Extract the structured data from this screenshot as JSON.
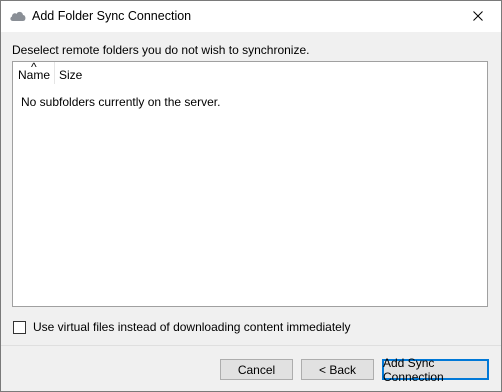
{
  "window": {
    "title": "Add Folder Sync Connection",
    "icon": "cloud-icon",
    "close_icon": "close-icon"
  },
  "instruction": "Deselect remote folders you do not wish to synchronize.",
  "tree": {
    "columns": [
      "Name",
      "Size"
    ],
    "sort_indicator": "^",
    "empty_message": "No subfolders currently on the server."
  },
  "options": {
    "virtual_files_label": "Use virtual files instead of downloading content immediately",
    "virtual_files_checked": false
  },
  "buttons": {
    "cancel": "Cancel",
    "back": "< Back",
    "add": "Add Sync Connection"
  },
  "colors": {
    "accent": "#0078d7",
    "dialog_bg": "#f0f0f0"
  }
}
